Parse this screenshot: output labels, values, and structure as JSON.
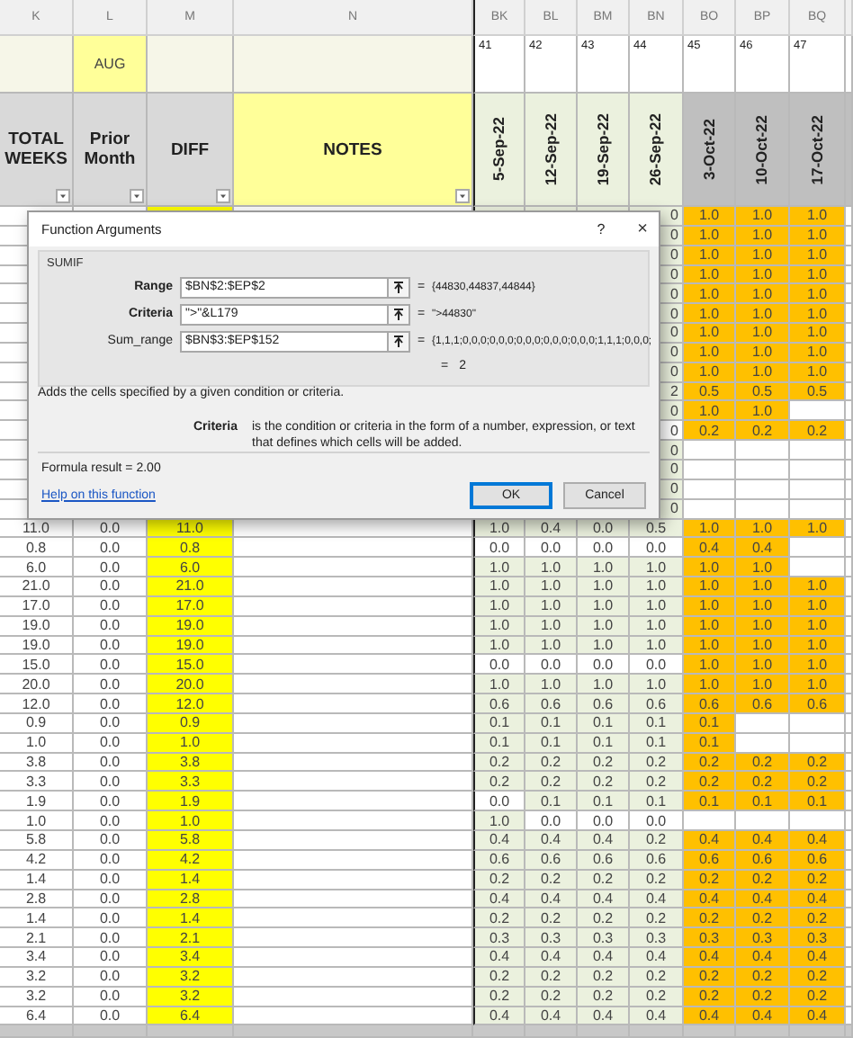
{
  "column_letters": [
    "K",
    "L",
    "M",
    "N",
    "BK",
    "BL",
    "BM",
    "BN",
    "BO",
    "BP",
    "BQ"
  ],
  "month_label": "AUG",
  "week_numbers": [
    "41",
    "42",
    "43",
    "44",
    "45",
    "46",
    "47"
  ],
  "column_titles": [
    "TOTAL WEEKS",
    "Prior Month",
    "DIFF",
    "NOTES"
  ],
  "week_dates": [
    "5-Sep-22",
    "12-Sep-22",
    "19-Sep-22",
    "26-Sep-22",
    "3-Oct-22",
    "10-Oct-22",
    "17-Oct-22"
  ],
  "covered_rows": [
    {
      "bn_edge": "0",
      "bn_white": false,
      "late": [
        "1.0",
        "1.0",
        "1.0"
      ]
    },
    {
      "bn_edge": "0",
      "bn_white": false,
      "late": [
        "1.0",
        "1.0",
        "1.0"
      ]
    },
    {
      "bn_edge": "0",
      "bn_white": false,
      "late": [
        "1.0",
        "1.0",
        "1.0"
      ]
    },
    {
      "bn_edge": "0",
      "bn_white": false,
      "late": [
        "1.0",
        "1.0",
        "1.0"
      ]
    },
    {
      "bn_edge": "0",
      "bn_white": false,
      "late": [
        "1.0",
        "1.0",
        "1.0"
      ]
    },
    {
      "bn_edge": "0",
      "bn_white": false,
      "late": [
        "1.0",
        "1.0",
        "1.0"
      ]
    },
    {
      "bn_edge": "0",
      "bn_white": false,
      "late": [
        "1.0",
        "1.0",
        "1.0"
      ]
    },
    {
      "bn_edge": "0",
      "bn_white": false,
      "late": [
        "1.0",
        "1.0",
        "1.0"
      ]
    },
    {
      "bn_edge": "0",
      "bn_white": false,
      "late": [
        "1.0",
        "1.0",
        "1.0"
      ]
    },
    {
      "bn_edge": "2",
      "bn_white": false,
      "late": [
        "0.5",
        "0.5",
        "0.5"
      ]
    },
    {
      "bn_edge": "0",
      "bn_white": false,
      "late": [
        "1.0",
        "1.0"
      ]
    },
    {
      "bn_edge": "0",
      "bn_white": true,
      "late": [
        "0.2",
        "0.2",
        "0.2"
      ]
    },
    {
      "bn_edge": "0",
      "bn_white": false
    },
    {
      "bn_edge": "0",
      "bn_white": false
    },
    {
      "bn_edge": "0",
      "bn_white": false
    },
    {
      "bn_edge": "0",
      "bn_white": false
    }
  ],
  "rows": [
    {
      "total": "11.0",
      "prior": "0.0",
      "diff": "11.0",
      "early": [
        "1.0",
        "0.4",
        "0.0",
        "0.5"
      ],
      "early_white": [
        false,
        false,
        false,
        false
      ],
      "late": [
        "1.0",
        "1.0",
        "1.0"
      ]
    },
    {
      "total": "0.8",
      "prior": "0.0",
      "diff": "0.8",
      "early": [
        "0.0",
        "0.0",
        "0.0",
        "0.0"
      ],
      "early_white": [
        true,
        true,
        true,
        true
      ],
      "late": [
        "0.4",
        "0.4"
      ]
    },
    {
      "total": "6.0",
      "prior": "0.0",
      "diff": "6.0",
      "early": [
        "1.0",
        "1.0",
        "1.0",
        "1.0"
      ],
      "early_white": [
        false,
        false,
        false,
        false
      ],
      "late": [
        "1.0",
        "1.0"
      ]
    },
    {
      "total": "21.0",
      "prior": "0.0",
      "diff": "21.0",
      "early": [
        "1.0",
        "1.0",
        "1.0",
        "1.0"
      ],
      "early_white": [
        false,
        false,
        false,
        false
      ],
      "late": [
        "1.0",
        "1.0",
        "1.0"
      ]
    },
    {
      "total": "17.0",
      "prior": "0.0",
      "diff": "17.0",
      "early": [
        "1.0",
        "1.0",
        "1.0",
        "1.0"
      ],
      "early_white": [
        false,
        false,
        false,
        false
      ],
      "late": [
        "1.0",
        "1.0",
        "1.0"
      ]
    },
    {
      "total": "19.0",
      "prior": "0.0",
      "diff": "19.0",
      "early": [
        "1.0",
        "1.0",
        "1.0",
        "1.0"
      ],
      "early_white": [
        false,
        false,
        false,
        false
      ],
      "late": [
        "1.0",
        "1.0",
        "1.0"
      ]
    },
    {
      "total": "19.0",
      "prior": "0.0",
      "diff": "19.0",
      "early": [
        "1.0",
        "1.0",
        "1.0",
        "1.0"
      ],
      "early_white": [
        false,
        false,
        false,
        false
      ],
      "late": [
        "1.0",
        "1.0",
        "1.0"
      ]
    },
    {
      "total": "15.0",
      "prior": "0.0",
      "diff": "15.0",
      "early": [
        "0.0",
        "0.0",
        "0.0",
        "0.0"
      ],
      "early_white": [
        true,
        true,
        true,
        true
      ],
      "late": [
        "1.0",
        "1.0",
        "1.0"
      ]
    },
    {
      "total": "20.0",
      "prior": "0.0",
      "diff": "20.0",
      "early": [
        "1.0",
        "1.0",
        "1.0",
        "1.0"
      ],
      "early_white": [
        false,
        false,
        false,
        false
      ],
      "late": [
        "1.0",
        "1.0",
        "1.0"
      ]
    },
    {
      "total": "12.0",
      "prior": "0.0",
      "diff": "12.0",
      "early": [
        "0.6",
        "0.6",
        "0.6",
        "0.6"
      ],
      "early_white": [
        false,
        false,
        false,
        false
      ],
      "late": [
        "0.6",
        "0.6",
        "0.6"
      ]
    },
    {
      "total": "0.9",
      "prior": "0.0",
      "diff": "0.9",
      "early": [
        "0.1",
        "0.1",
        "0.1",
        "0.1"
      ],
      "early_white": [
        false,
        false,
        false,
        false
      ],
      "late": [
        "0.1"
      ]
    },
    {
      "total": "1.0",
      "prior": "0.0",
      "diff": "1.0",
      "early": [
        "0.1",
        "0.1",
        "0.1",
        "0.1"
      ],
      "early_white": [
        false,
        false,
        false,
        false
      ],
      "late": [
        "0.1"
      ]
    },
    {
      "total": "3.8",
      "prior": "0.0",
      "diff": "3.8",
      "early": [
        "0.2",
        "0.2",
        "0.2",
        "0.2"
      ],
      "early_white": [
        false,
        false,
        false,
        false
      ],
      "late": [
        "0.2",
        "0.2",
        "0.2"
      ]
    },
    {
      "total": "3.3",
      "prior": "0.0",
      "diff": "3.3",
      "early": [
        "0.2",
        "0.2",
        "0.2",
        "0.2"
      ],
      "early_white": [
        false,
        false,
        false,
        false
      ],
      "late": [
        "0.2",
        "0.2",
        "0.2"
      ]
    },
    {
      "total": "1.9",
      "prior": "0.0",
      "diff": "1.9",
      "early": [
        "0.0",
        "0.1",
        "0.1",
        "0.1"
      ],
      "early_white": [
        true,
        false,
        false,
        false
      ],
      "late": [
        "0.1",
        "0.1",
        "0.1"
      ]
    },
    {
      "total": "1.0",
      "prior": "0.0",
      "diff": "1.0",
      "early": [
        "1.0",
        "0.0",
        "0.0",
        "0.0"
      ],
      "early_white": [
        false,
        true,
        true,
        true
      ]
    },
    {
      "total": "5.8",
      "prior": "0.0",
      "diff": "5.8",
      "early": [
        "0.4",
        "0.4",
        "0.4",
        "0.2"
      ],
      "early_white": [
        false,
        false,
        false,
        false
      ],
      "late": [
        "0.4",
        "0.4",
        "0.4"
      ]
    },
    {
      "total": "4.2",
      "prior": "0.0",
      "diff": "4.2",
      "early": [
        "0.6",
        "0.6",
        "0.6",
        "0.6"
      ],
      "early_white": [
        false,
        false,
        false,
        false
      ],
      "late": [
        "0.6",
        "0.6",
        "0.6"
      ]
    },
    {
      "total": "1.4",
      "prior": "0.0",
      "diff": "1.4",
      "early": [
        "0.2",
        "0.2",
        "0.2",
        "0.2"
      ],
      "early_white": [
        false,
        false,
        false,
        false
      ],
      "late": [
        "0.2",
        "0.2",
        "0.2"
      ]
    },
    {
      "total": "2.8",
      "prior": "0.0",
      "diff": "2.8",
      "early": [
        "0.4",
        "0.4",
        "0.4",
        "0.4"
      ],
      "early_white": [
        false,
        false,
        false,
        false
      ],
      "late": [
        "0.4",
        "0.4",
        "0.4"
      ]
    },
    {
      "total": "1.4",
      "prior": "0.0",
      "diff": "1.4",
      "early": [
        "0.2",
        "0.2",
        "0.2",
        "0.2"
      ],
      "early_white": [
        false,
        false,
        false,
        false
      ],
      "late": [
        "0.2",
        "0.2",
        "0.2"
      ]
    },
    {
      "total": "2.1",
      "prior": "0.0",
      "diff": "2.1",
      "early": [
        "0.3",
        "0.3",
        "0.3",
        "0.3"
      ],
      "early_white": [
        false,
        false,
        false,
        false
      ],
      "late": [
        "0.3",
        "0.3",
        "0.3"
      ]
    },
    {
      "total": "3.4",
      "prior": "0.0",
      "diff": "3.4",
      "early": [
        "0.4",
        "0.4",
        "0.4",
        "0.4"
      ],
      "early_white": [
        false,
        false,
        false,
        false
      ],
      "late": [
        "0.4",
        "0.4",
        "0.4"
      ]
    },
    {
      "total": "3.2",
      "prior": "0.0",
      "diff": "3.2",
      "early": [
        "0.2",
        "0.2",
        "0.2",
        "0.2"
      ],
      "early_white": [
        false,
        false,
        false,
        false
      ],
      "late": [
        "0.2",
        "0.2",
        "0.2"
      ]
    },
    {
      "total": "3.2",
      "prior": "0.0",
      "diff": "3.2",
      "early": [
        "0.2",
        "0.2",
        "0.2",
        "0.2"
      ],
      "early_white": [
        false,
        false,
        false,
        false
      ],
      "late": [
        "0.2",
        "0.2",
        "0.2"
      ]
    },
    {
      "total": "6.4",
      "prior": "0.0",
      "diff": "6.4",
      "early": [
        "0.4",
        "0.4",
        "0.4",
        "0.4"
      ],
      "early_white": [
        false,
        false,
        false,
        false
      ],
      "late": [
        "0.4",
        "0.4",
        "0.4"
      ]
    }
  ],
  "dialog": {
    "title": "Function Arguments",
    "help_glyph": "?",
    "close_glyph": "×",
    "function": "SUMIF",
    "arguments": [
      {
        "label": "Range",
        "required": true,
        "value": "$BN$2:$EP$2",
        "equals": "=",
        "result": "{44830,44837,44844}"
      },
      {
        "label": "Criteria",
        "required": true,
        "value": "\">\"&L179",
        "equals": "=",
        "result": "\">44830\""
      },
      {
        "label": "Sum_range",
        "required": false,
        "value": "$BN$3:$EP$152",
        "equals": "=",
        "result": "{1,1,1;0,0,0;0,0,0;0,0,0;0,0,0;0,0,0;1,1,1;0,0,0;"
      }
    ],
    "total_equals": "=",
    "total": "2",
    "description": "Adds the cells specified by a given condition or criteria.",
    "arg_name": "Criteria",
    "arg_help": "is the condition or criteria in the form of a number, expression, or text that defines which cells will be added.",
    "result_label": "Formula result =",
    "result_value": "2.00",
    "help_link": "Help on this function",
    "buttons": [
      {
        "label": "OK",
        "default": true
      },
      {
        "label": "Cancel",
        "default": false
      }
    ]
  }
}
